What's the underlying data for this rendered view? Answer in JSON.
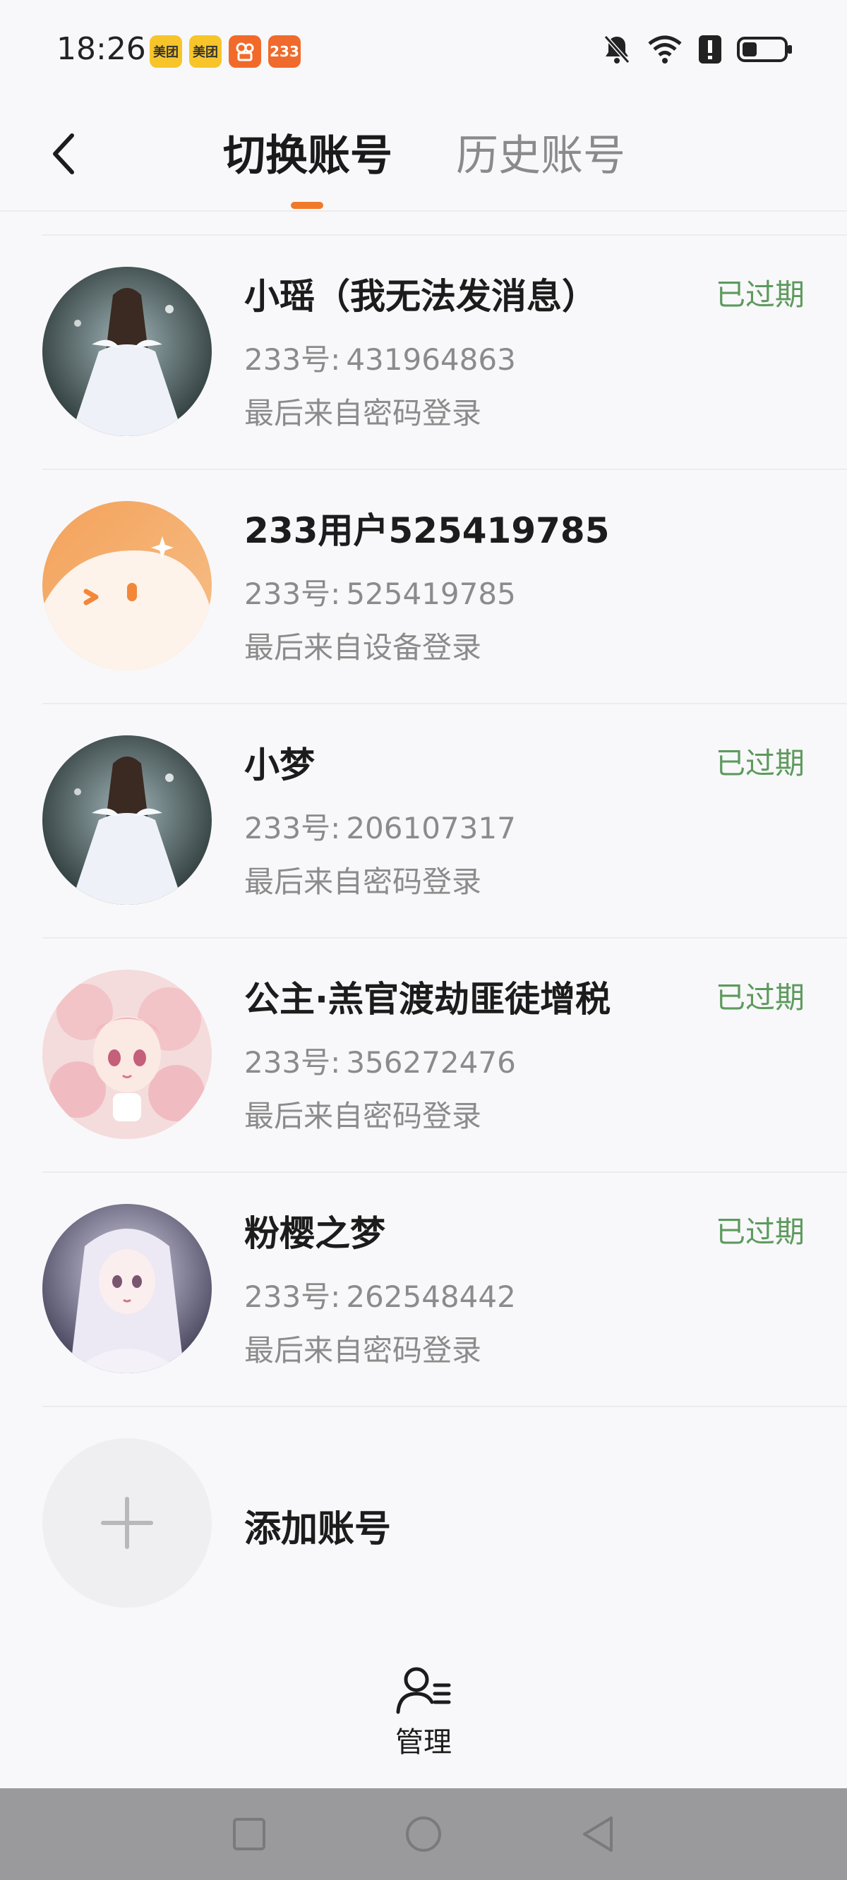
{
  "status_bar": {
    "time": "18:26",
    "badges": [
      "美团",
      "美团",
      "快手",
      "233"
    ]
  },
  "header": {
    "tab_switch": "切换账号",
    "tab_history": "历史账号"
  },
  "accounts": [
    {
      "name": "小瑶（我无法发消息）",
      "id_label": "233号:",
      "id": "431964863",
      "login": "最后来自密码登录",
      "status": "已过期",
      "avatar_icon": "girl-white-dress-avatar"
    },
    {
      "name": "233用户525419785",
      "id_label": "233号:",
      "id": "525419785",
      "login": "最后来自设备登录",
      "status": "",
      "avatar_icon": "default-orange-avatar"
    },
    {
      "name": "小梦",
      "id_label": "233号:",
      "id": "206107317",
      "login": "最后来自密码登录",
      "status": "已过期",
      "avatar_icon": "girl-white-dress-avatar"
    },
    {
      "name": "公主·羔官渡劫匪徒增税",
      "id_label": "233号:",
      "id": "356272476",
      "login": "最后来自密码登录",
      "status": "已过期",
      "avatar_icon": "pink-anime-girl-avatar"
    },
    {
      "name": "粉樱之梦",
      "id_label": "233号:",
      "id": "262548442",
      "login": "最后来自密码登录",
      "status": "已过期",
      "avatar_icon": "silver-anime-girl-avatar"
    }
  ],
  "add_account": {
    "label": "添加账号"
  },
  "bottom": {
    "manage_label": "管理"
  },
  "colors": {
    "accent": "#f07a2a",
    "expired": "#5d9a5d",
    "secondary_text": "#8b8b8b"
  }
}
